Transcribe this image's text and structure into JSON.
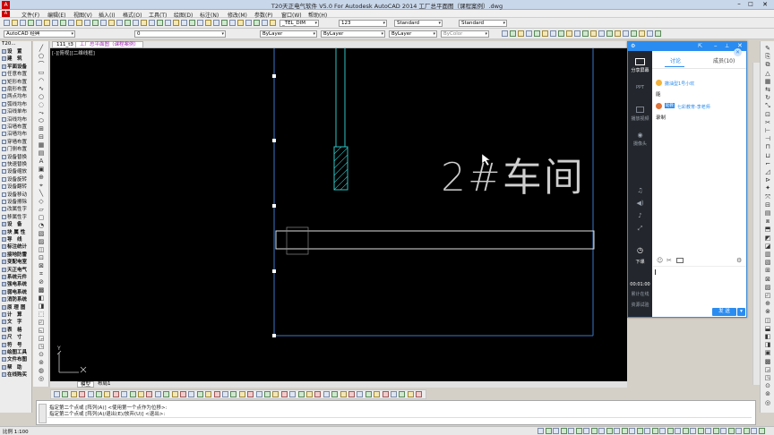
{
  "window": {
    "title": "T20天正电气软件 V5.0 For Autodesk AutoCAD 2014    工厂总平面图（课程案例）.dwg"
  },
  "menu": [
    "文件(F)",
    "编辑(E)",
    "视图(V)",
    "插入(I)",
    "格式(O)",
    "工具(T)",
    "绘图(D)",
    "标注(N)",
    "修改(M)",
    "参数(P)",
    "窗口(W)",
    "帮助(H)"
  ],
  "toolbar": {
    "workspace": "AutoCAD 经典",
    "layer": "0",
    "layer_combo": "ByLayer",
    "linetype": "ByLayer",
    "lineweight": "ByLayer",
    "plotstyle": "ByColor",
    "dimstyle": "_TEL_DIM",
    "textheight": "123",
    "textstyle": "Standard",
    "tablestyle": "Standard"
  },
  "left_panel": {
    "title": "T20...",
    "items": [
      "设　置",
      "建　筑",
      "平面设备",
      "任意布置",
      "矩形布置",
      "扇形布置",
      "两点均布",
      "弧线均布",
      "沿线单布",
      "沿线均布",
      "沿墙布置",
      "沿墙均布",
      "穿墙布置",
      "门侧布置",
      "设备替换",
      "快速替换",
      "设备缩放",
      "设备旋转",
      "设备翻转",
      "设备移动",
      "设备擦除",
      "改属性字",
      "移属性字",
      "设　备",
      "块 属 性",
      "导　线",
      "标注统计",
      "接地防雷",
      "变配电室",
      "天正电气",
      "系统元件",
      "强电系统",
      "弱电系统",
      "消防系统",
      "原 理 图",
      "计　算",
      "文　字",
      "表　格",
      "尺　寸",
      "符　号",
      "绘图工具",
      "文件布图",
      "帮　助",
      "在线购买"
    ]
  },
  "doc_tabs": [
    "111_t3",
    "工厂总平面图（课程案例）"
  ],
  "viewport_label": "[-][俯视][二维线框]",
  "drawing_text": "2#车间",
  "layout_tabs": [
    "模型",
    "布局1"
  ],
  "command_lines": [
    "指定第二个点或 [阵列(A)] <使用第一个点作为位移>:",
    "指定第二个点或 [阵列(A)/退出(E)/放弃(U)] <退出>:"
  ],
  "status": {
    "scale": "比例 1:100"
  },
  "chat": {
    "share_label": "分享屏幕",
    "tab_discuss": "讨论",
    "tab_members": "成员(10)",
    "side_items": [
      "PPT",
      "播放视频",
      "摄像头",
      "下课"
    ],
    "timer": "00:01:00",
    "timer_label": "累计在线",
    "exam_label": "资源试验",
    "messages": [
      {
        "name": "撒油型1号小欢",
        "text": "能"
      },
      {
        "name": "七彩教育-李老师",
        "badge": "助教",
        "text": "录制"
      }
    ],
    "send_label": "发 送",
    "colors": {
      "accent": "#2a8cf0",
      "dark": "#23262c"
    }
  }
}
